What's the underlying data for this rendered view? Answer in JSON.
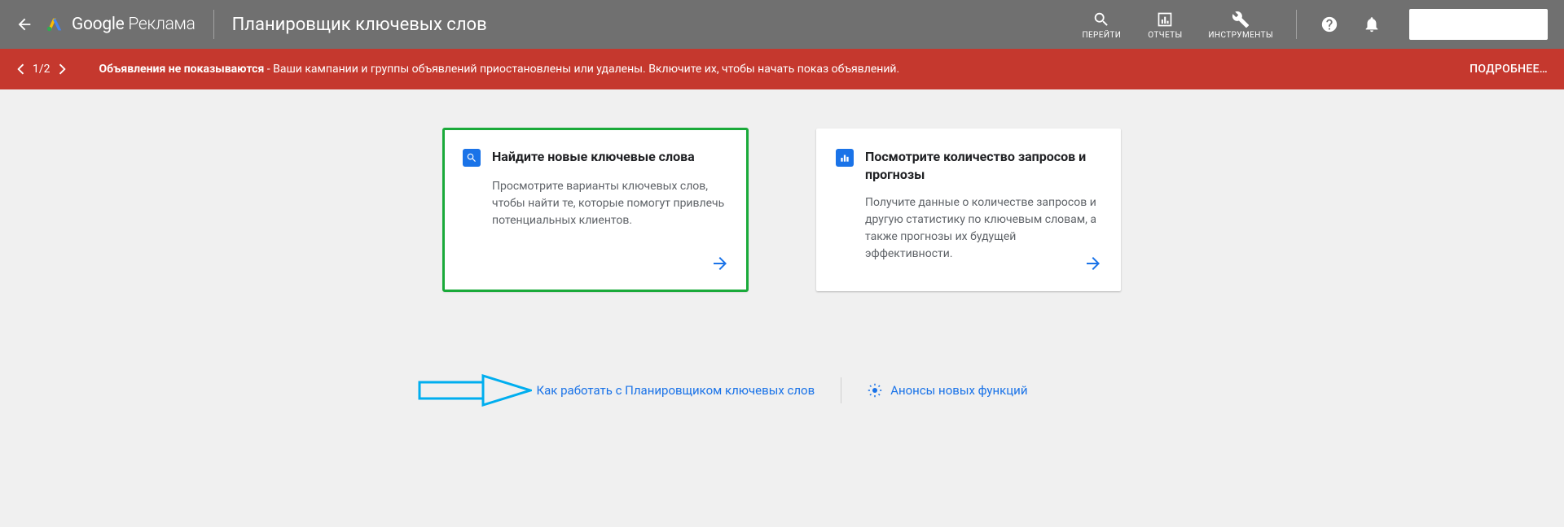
{
  "header": {
    "brand_google": "Google",
    "brand_product": "Реклама",
    "page_title": "Планировщик ключевых слов",
    "tools": {
      "search": "ПЕРЕЙТИ",
      "reports": "ОТЧЕТЫ",
      "instruments": "ИНСТРУМЕНТЫ"
    }
  },
  "alert": {
    "index": "1/2",
    "strong": "Объявления не показываются",
    "separator": " - ",
    "message": "Ваши кампании и группы объявлений приостановлены или удалены. Включите их, чтобы начать показ объявлений.",
    "more": "ПОДРОБНЕЕ…"
  },
  "cards": {
    "find": {
      "title": "Найдите новые ключевые слова",
      "desc": "Просмотрите варианты ключевых слов, чтобы найти те, которые помогут привлечь потенциальных клиентов."
    },
    "forecast": {
      "title": "Посмотрите количество запросов и прогнозы",
      "desc": "Получите данные о количестве запросов и другую статистику по ключевым словам, а также прогнозы их будущей эффективности."
    }
  },
  "footer": {
    "howto": "Как работать с Планировщиком ключевых слов",
    "announcements": "Анонсы новых функций"
  }
}
